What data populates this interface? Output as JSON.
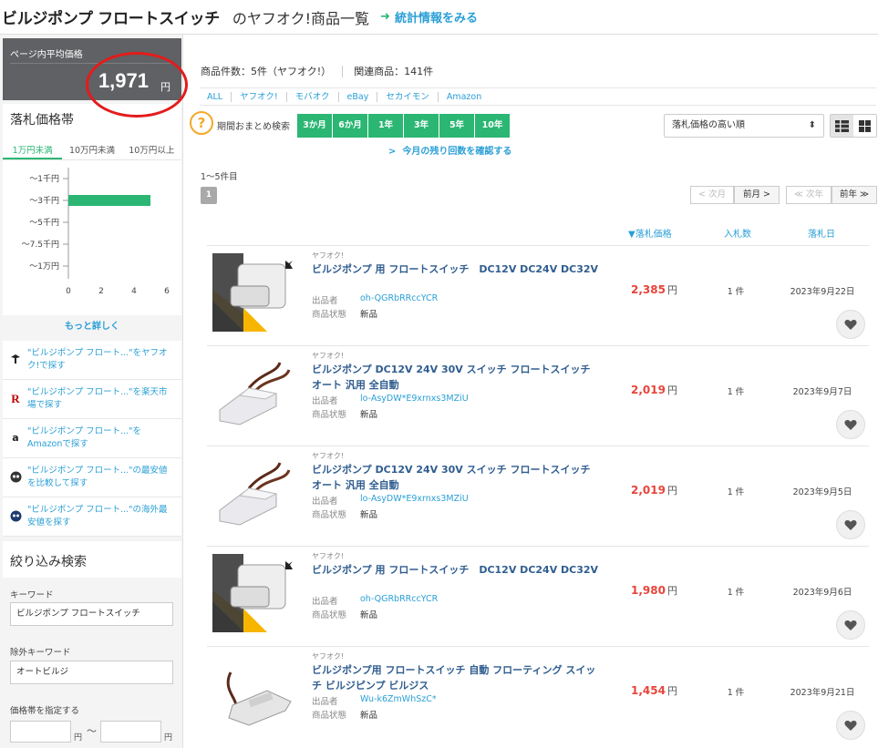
{
  "header": {
    "keyword": "ビルジポンプ フロートスイッチ",
    "suffix": "のヤフオク!商品一覧",
    "stats_link": "統計情報をみる"
  },
  "sidebar": {
    "avg_label": "ページ内平均価格",
    "avg_value": "1,971",
    "avg_unit": "円",
    "price_band_title": "落札価格帯",
    "tabs": [
      "1万円未満",
      "10万円未満",
      "10万円以上"
    ],
    "chart_data": {
      "type": "bar",
      "orientation": "horizontal",
      "categories": [
        "〜1千円",
        "〜3千円",
        "〜5千円",
        "〜7.5千円",
        "〜1万円"
      ],
      "values": [
        0,
        5,
        0,
        0,
        0
      ],
      "xticks": [
        "0",
        "2",
        "4",
        "6"
      ],
      "xlim": [
        0,
        6
      ],
      "color": "#2bb673"
    },
    "more_label": "もっと詳しく",
    "links": [
      {
        "icon": "yahoo-auction-icon",
        "text": "\"ビルジポンプ フロート...\"をヤフオク!で探す"
      },
      {
        "icon": "rakuten-icon",
        "text": "\"ビルジポンプ フロート...\"を楽天市場で探す"
      },
      {
        "icon": "amazon-icon",
        "text": "\"ビルジポンプ フロート...\"をAmazonで探す"
      },
      {
        "icon": "price-compare-icon",
        "text": "\"ビルジポンプ フロート...\"の最安値を比較して探す"
      },
      {
        "icon": "globe-icon",
        "text": "\"ビルジポンプ フロート...\"の海外最安値を探す"
      }
    ],
    "filter_title": "絞り込み検索",
    "keyword_label": "キーワード",
    "keyword_value": "ビルジポンプ フロートスイッチ",
    "exclude_label": "除外キーワード",
    "exclude_value": "オートビルジ",
    "price_range_label": "価格帯を指定する",
    "yen": "円",
    "tilde": "〜"
  },
  "main": {
    "count_text": "商品件数：5件（ヤフオク!）",
    "related_text": "関連商品：141件",
    "sources": [
      "ALL",
      "ヤフオク!",
      "モバオク",
      "eBay",
      "セカイモン",
      "Amazon"
    ],
    "period_label": "期間おまとめ検索",
    "periods": [
      "3か月",
      "6か月",
      "1年",
      "3年",
      "5年",
      "10年"
    ],
    "remain_link": "今月の残り回数を確認する",
    "sort_value": "落札価格の高い順",
    "range_text": "1〜5件目",
    "page": "1",
    "nav": {
      "prev_month": "次月",
      "next_month": "前月",
      "prev_year": "次年",
      "next_year": "前年"
    },
    "columns": {
      "price": "落札価格",
      "bids": "入札数",
      "date": "落札日"
    },
    "labels": {
      "source": "ヤフオク!",
      "seller": "出品者",
      "condition": "商品状態",
      "yen": "円"
    },
    "items": [
      {
        "name": "ビルジポンプ 用 フロートスイッチ　DC12V DC24V DC32V",
        "seller": "oh-QGRbRRccYCR",
        "condition": "新品",
        "price": "2,385",
        "bids": "1 件",
        "date": "2023年9月22日",
        "img": "yellow"
      },
      {
        "name": "ビルジポンプ DC12V 24V 30V スイッチ フロートスイッチ オート 汎用 全自動",
        "seller": "lo-AsyDW*E9xrnxs3MZiU",
        "condition": "新品",
        "price": "2,019",
        "bids": "1 件",
        "date": "2023年9月7日",
        "img": "white"
      },
      {
        "name": "ビルジポンプ DC12V 24V 30V スイッチ フロートスイッチ オート 汎用 全自動",
        "seller": "lo-AsyDW*E9xrnxs3MZiU",
        "condition": "新品",
        "price": "2,019",
        "bids": "1 件",
        "date": "2023年9月5日",
        "img": "white"
      },
      {
        "name": "ビルジポンプ 用 フロートスイッチ　DC12V DC24V DC32V",
        "seller": "oh-QGRbRRccYCR",
        "condition": "新品",
        "price": "1,980",
        "bids": "1 件",
        "date": "2023年9月6日",
        "img": "yellow"
      },
      {
        "name": "ビルジポンプ用 フロートスイッチ 自動 フローティング スイッチ ビルジピンプ ビルジス",
        "seller": "Wu-k6ZmWhSzC*",
        "condition": "新品",
        "price": "1,454",
        "bids": "1 件",
        "date": "2023年9月21日",
        "img": "small"
      }
    ]
  }
}
